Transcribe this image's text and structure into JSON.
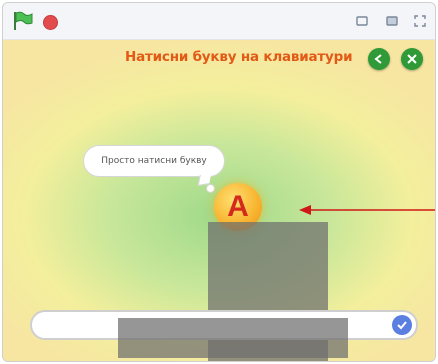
{
  "topbar": {
    "flag_icon": "green-flag-icon",
    "stop_icon": "stop-sign-icon",
    "small_stage_icon": "small-stage-icon",
    "large_stage_icon": "large-stage-icon",
    "fullscreen_icon": "fullscreen-icon"
  },
  "stage": {
    "title": "Натисни букву на клавиатури",
    "back_icon": "back-arrow-icon",
    "close_icon": "close-icon",
    "speech_text": "Просто натисни букву",
    "sprite_letter": "A"
  },
  "answer": {
    "value": "",
    "submit_icon": "check-icon"
  },
  "colors": {
    "title": "#e35a16",
    "button_green": "#2f9a37",
    "sprite_letter": "#d42a1d",
    "arrow": "#d01818",
    "submit_blue": "#5b7fe0"
  }
}
